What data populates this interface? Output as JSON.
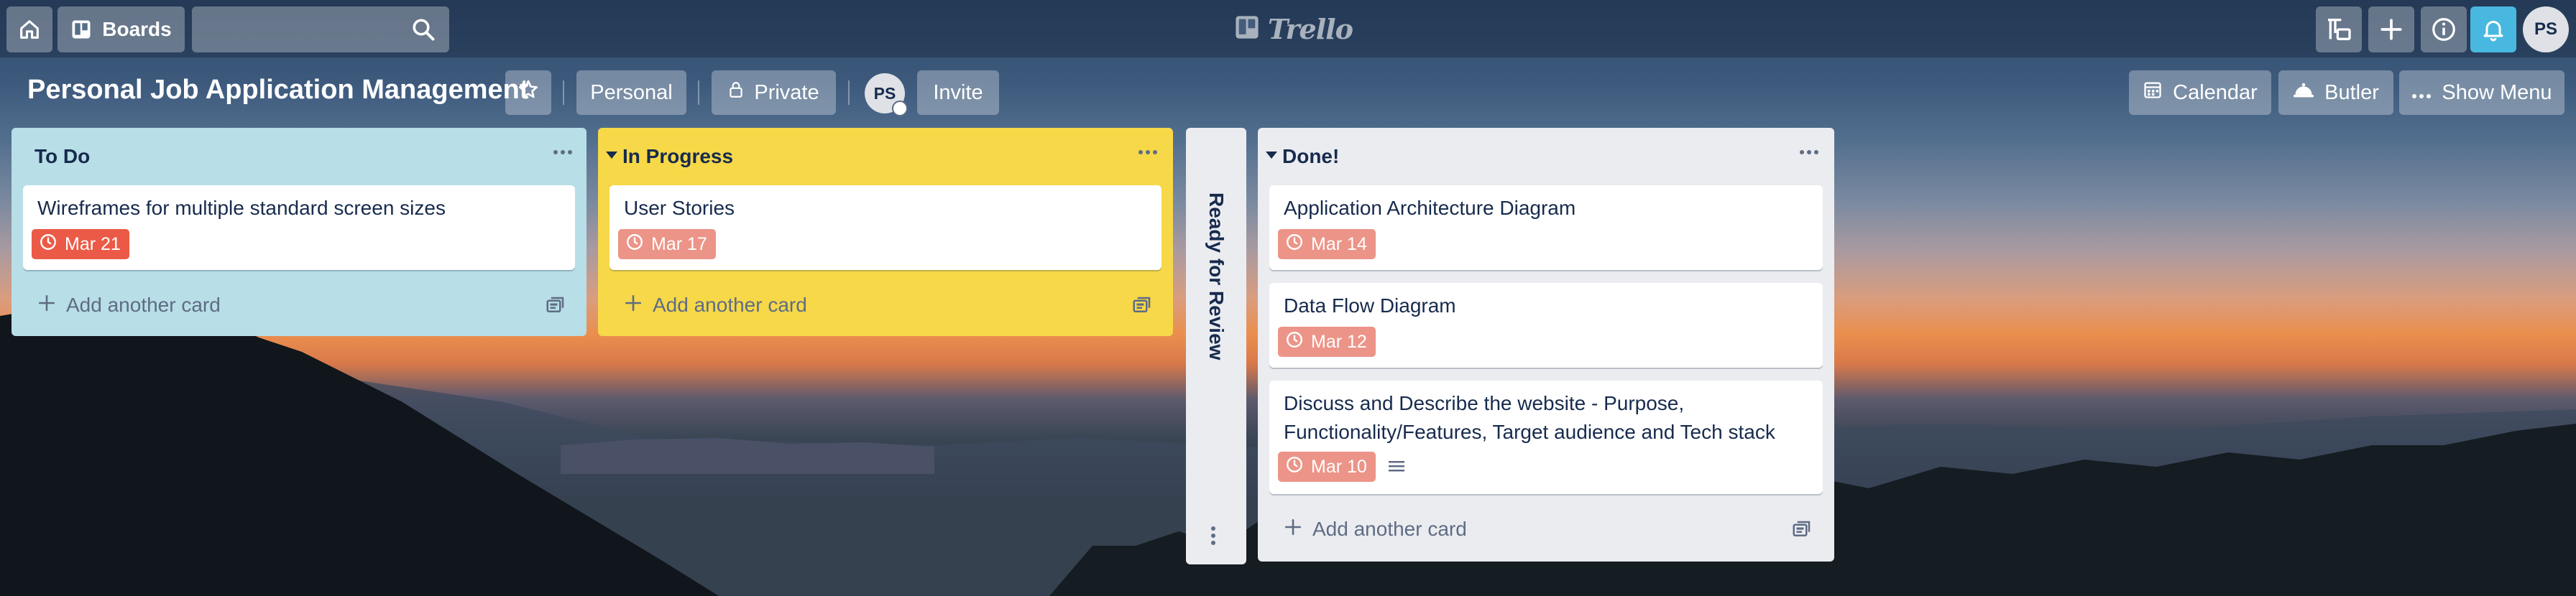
{
  "header": {
    "boards_label": "Boards",
    "search_value": "",
    "logo_text": "Trello",
    "user_initials": "PS"
  },
  "board": {
    "title": "Personal Job Application Management",
    "team_label": "Personal",
    "visibility_label": "Private",
    "member_initials": "PS",
    "invite_label": "Invite",
    "calendar_label": "Calendar",
    "butler_label": "Butler",
    "show_menu_label": "Show Menu"
  },
  "lists": [
    {
      "title": "To Do",
      "color": "#b8dee7",
      "cards": [
        {
          "text": "Wireframes for multiple standard screen sizes",
          "due": "Mar 21",
          "due_color": "#eb5a46"
        }
      ],
      "add_card_label": "Add another card"
    },
    {
      "title": "In Progress",
      "color": "#f6d849",
      "cards": [
        {
          "text": "User Stories",
          "due": "Mar 17",
          "due_color": "#ec9488"
        }
      ],
      "add_card_label": "Add another card"
    },
    {
      "title": "Ready for Review",
      "collapsed": true,
      "cards": []
    },
    {
      "title": "Done!",
      "color": "#ebecf0",
      "cards": [
        {
          "text": "Application Architecture Diagram",
          "due": "Mar 14",
          "due_color": "#ec9488"
        },
        {
          "text": "Data Flow Diagram",
          "due": "Mar 12",
          "due_color": "#ec9488"
        },
        {
          "text": "Discuss and Describe the website - Purpose, Functionality/Features, Target audience and Tech stack",
          "due": "Mar 10",
          "due_color": "#ec9488",
          "has_description": true
        }
      ],
      "add_card_label": "Add another card"
    }
  ],
  "colors": {
    "header_button_bg": "rgba(255,255,255,0.3)",
    "notification_active": "#49b8e0",
    "due_overdue": "#eb5a46",
    "due_complete": "#ec9488",
    "text_dark": "#172b4d",
    "text_muted": "#5e6c84"
  },
  "icons": [
    "home-icon",
    "boards-icon",
    "search-icon",
    "trello-logo-icon",
    "board-switcher-icon",
    "plus-icon",
    "info-icon",
    "bell-icon",
    "star-icon",
    "lock-icon",
    "calendar-icon",
    "butler-icon",
    "more-icon",
    "collapse-icon",
    "plus-icon",
    "card-template-icon",
    "clock-icon",
    "description-icon",
    "menu-dots-icon"
  ]
}
